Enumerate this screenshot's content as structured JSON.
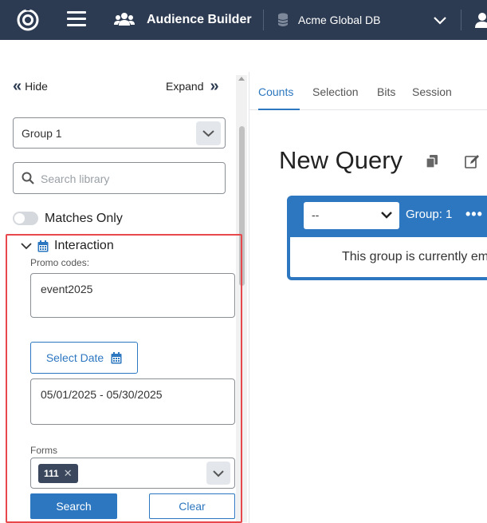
{
  "header": {
    "app_title": "Audience Builder",
    "database": "Acme Global DB",
    "icons": [
      "logo-icon",
      "hamburger-icon",
      "users-icon",
      "database-icon",
      "chevron-down-icon",
      "user-icon"
    ]
  },
  "sidebar": {
    "hide_label": "Hide",
    "expand_label": "Expand",
    "group_select": "Group 1",
    "search_placeholder": "Search library",
    "matches_only_label": "Matches Only",
    "matches_only_on": false,
    "section": {
      "title": "Interaction",
      "promo_label": "Promo codes:",
      "promo_value": "event2025",
      "select_date_label": "Select Date",
      "date_range": "05/01/2025 - 05/30/2025",
      "forms_label": "Forms",
      "forms_chip": "111",
      "search_button": "Search",
      "clear_button": "Clear"
    }
  },
  "main": {
    "tabs": [
      {
        "label": "Counts",
        "active": true
      },
      {
        "label": "Selection",
        "active": false
      },
      {
        "label": "Bits",
        "active": false
      },
      {
        "label": "Session",
        "active": false
      }
    ],
    "query_title": "New Query",
    "group": {
      "operator": "--",
      "label": "Group: 1",
      "empty_text": "This group is currently empty"
    }
  },
  "colors": {
    "topbar": "#2c3b52",
    "accent": "#2d77c0",
    "highlight": "#e8474c",
    "chip": "#3a475c"
  }
}
